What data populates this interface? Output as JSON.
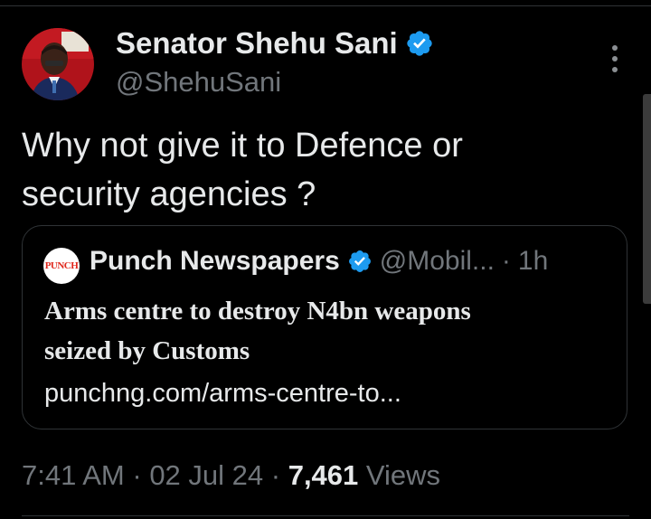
{
  "author": {
    "display_name": "Senator Shehu Sani",
    "handle": "@ShehuSani",
    "verified": true,
    "avatar": "profile-photo"
  },
  "tweet": {
    "text_line1": "Why not give it to Defence or",
    "text_line2": "security agencies ?"
  },
  "quoted_tweet": {
    "logo_text": "PUNCH",
    "display_name": "Punch Newspapers",
    "handle": "@Mobil...",
    "separator": "·",
    "time": "1h",
    "title_line1": "Arms centre to destroy N4bn weapons",
    "title_line2": "seized by Customs",
    "link": "punchng.com/arms-centre-to..."
  },
  "meta": {
    "time": "7:41 AM",
    "separator1": " · ",
    "date": "02 Jul 24",
    "separator2": " · ",
    "views_count": "7,461",
    "views_label": " Views"
  },
  "icons": {
    "verified": "verified-badge-icon",
    "more": "more-vertical-icon"
  },
  "colors": {
    "background": "#000000",
    "text_primary": "#e7e9ea",
    "text_secondary": "#71767b",
    "verified_blue": "#1d9bf0",
    "border": "#2f3336",
    "punch_red": "#e0261b"
  }
}
